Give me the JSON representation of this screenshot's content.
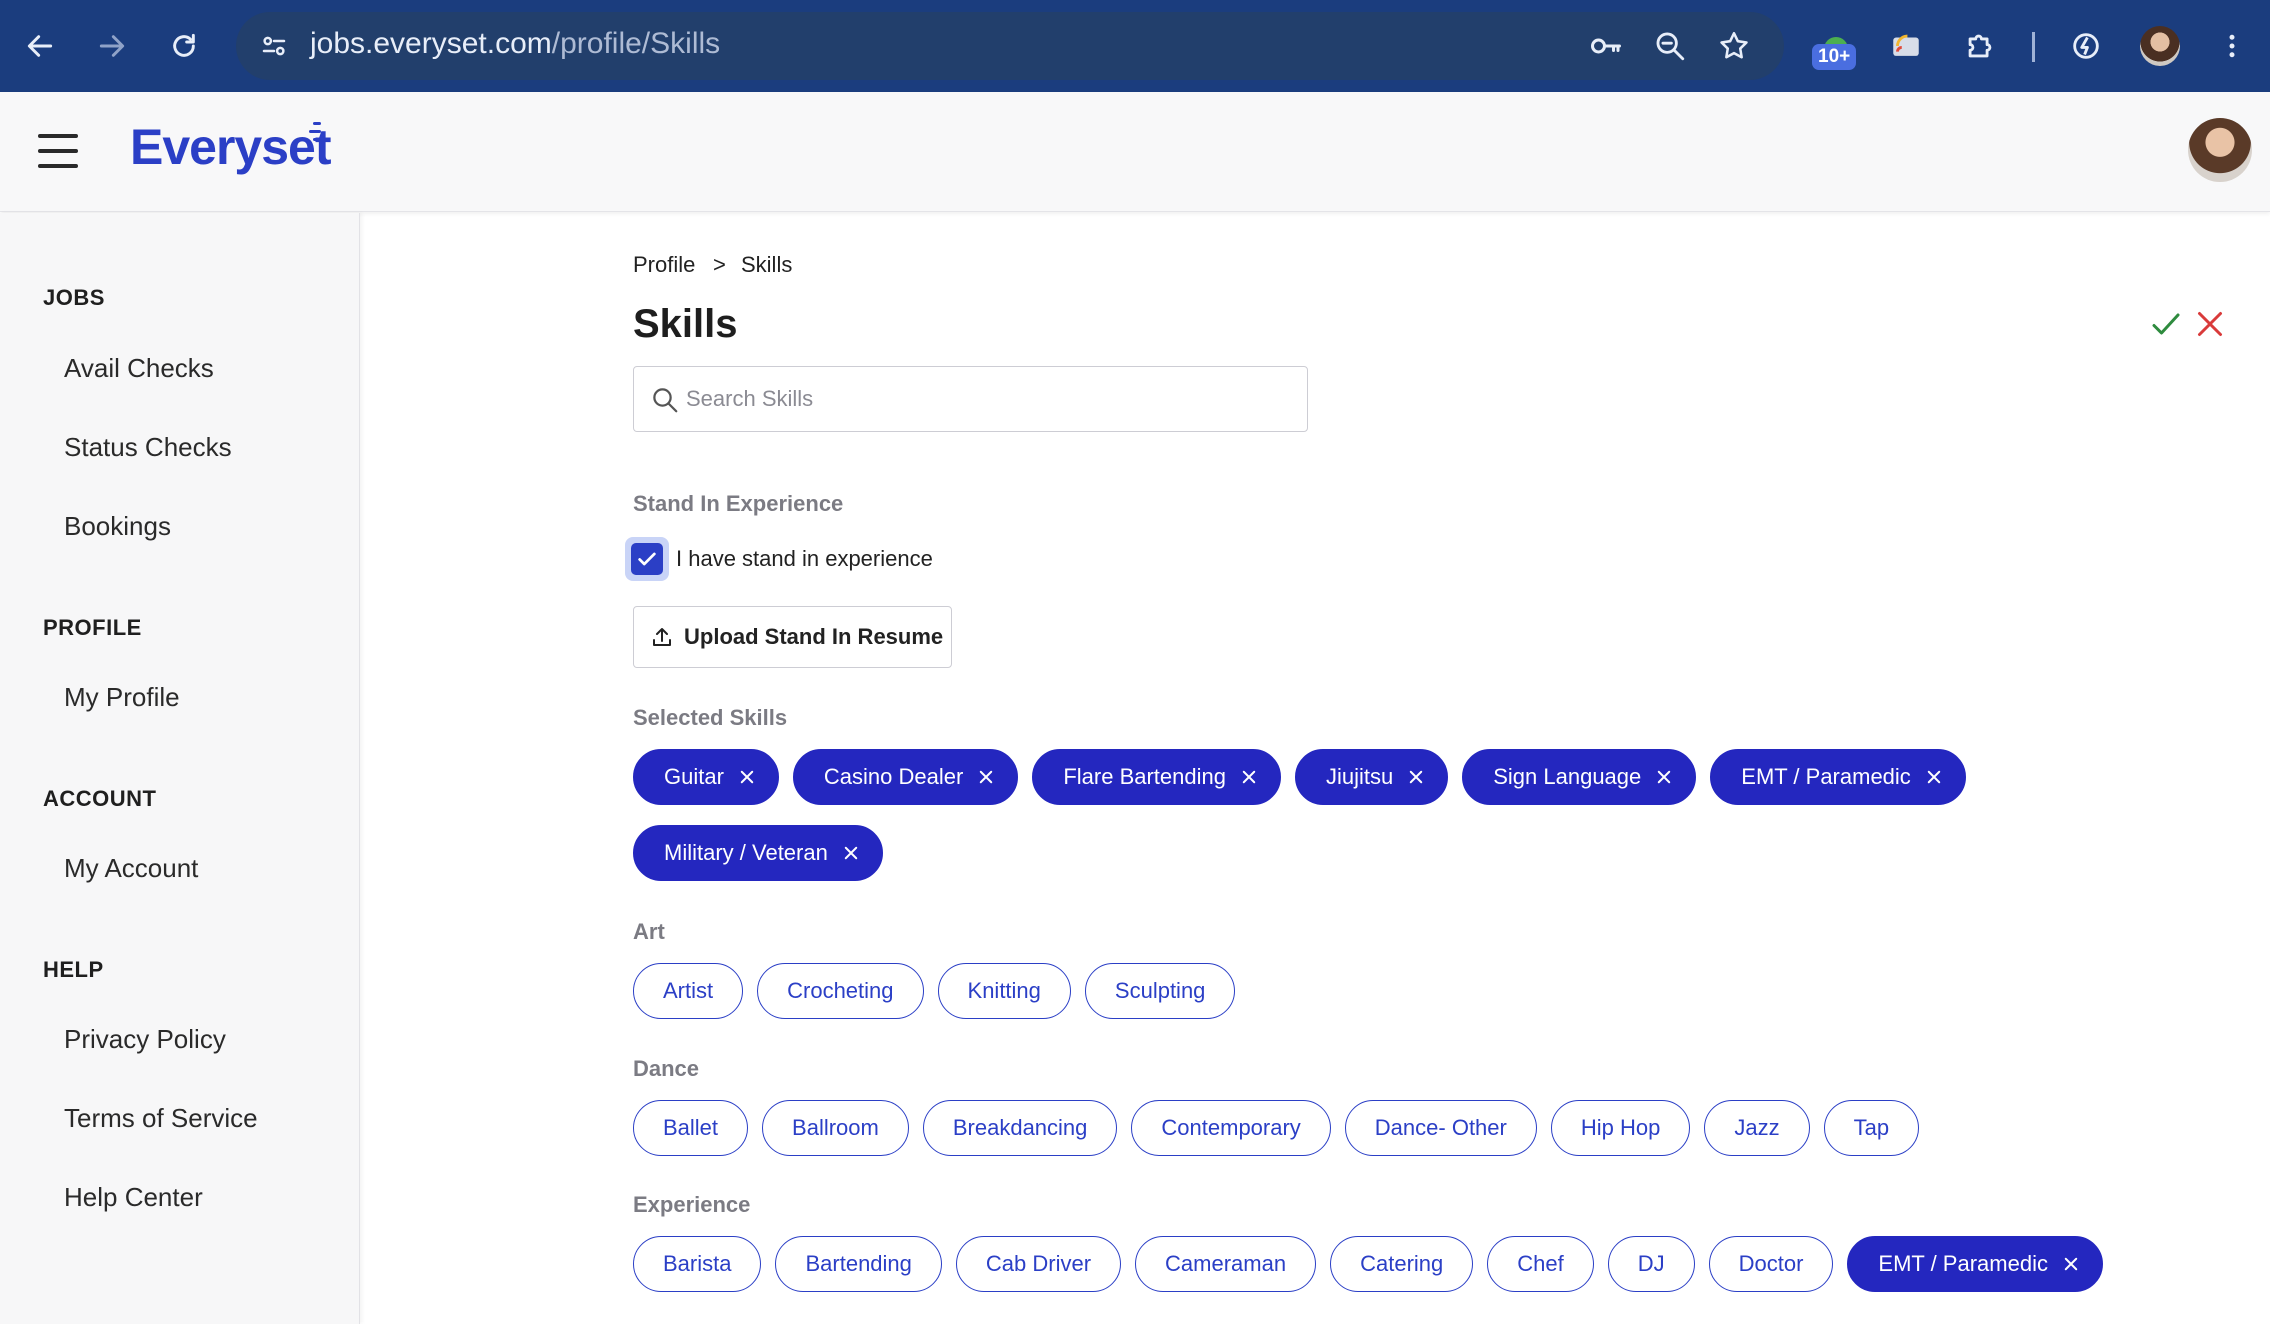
{
  "browser": {
    "url_host": "jobs.everyset.com",
    "url_path": "/profile/Skills",
    "extension_badge": "10+"
  },
  "app": {
    "logo": "Everyset"
  },
  "sidebar": {
    "sections": [
      {
        "heading": "JOBS",
        "items": [
          "Avail Checks",
          "Status Checks",
          "Bookings"
        ]
      },
      {
        "heading": "PROFILE",
        "items": [
          "My Profile"
        ]
      },
      {
        "heading": "ACCOUNT",
        "items": [
          "My Account"
        ]
      },
      {
        "heading": "HELP",
        "items": [
          "Privacy Policy",
          "Terms of Service",
          "Help Center"
        ]
      }
    ]
  },
  "breadcrumb": {
    "parent": "Profile",
    "separator": ">",
    "current": "Skills"
  },
  "page": {
    "title": "Skills",
    "search_placeholder": "Search Skills"
  },
  "stand_in": {
    "label": "Stand In Experience",
    "checkbox_label": "I have stand in experience",
    "checked": true,
    "upload_label": "Upload Stand In Resume"
  },
  "selected_skills": {
    "label": "Selected Skills",
    "items": [
      "Guitar",
      "Casino Dealer",
      "Flare Bartending",
      "Jiujitsu",
      "Sign Language",
      "EMT / Paramedic",
      "Military / Veteran"
    ]
  },
  "categories": [
    {
      "label": "Art",
      "items": [
        "Artist",
        "Crocheting",
        "Knitting",
        "Sculpting"
      ]
    },
    {
      "label": "Dance",
      "items": [
        "Ballet",
        "Ballroom",
        "Breakdancing",
        "Contemporary",
        "Dance- Other",
        "Hip Hop",
        "Jazz",
        "Tap"
      ]
    },
    {
      "label": "Experience",
      "items": [
        "Barista",
        "Bartending",
        "Cab Driver",
        "Cameraman",
        "Catering",
        "Chef",
        "DJ",
        "Doctor",
        "EMT / Paramedic"
      ],
      "selected": [
        "EMT / Paramedic"
      ]
    }
  ],
  "colors": {
    "brand": "#2b3fc6",
    "selected_chip": "#2427bf",
    "confirm": "#2e8b3e",
    "cancel": "#d93a3a",
    "browser_bar": "#1b3d7e"
  }
}
